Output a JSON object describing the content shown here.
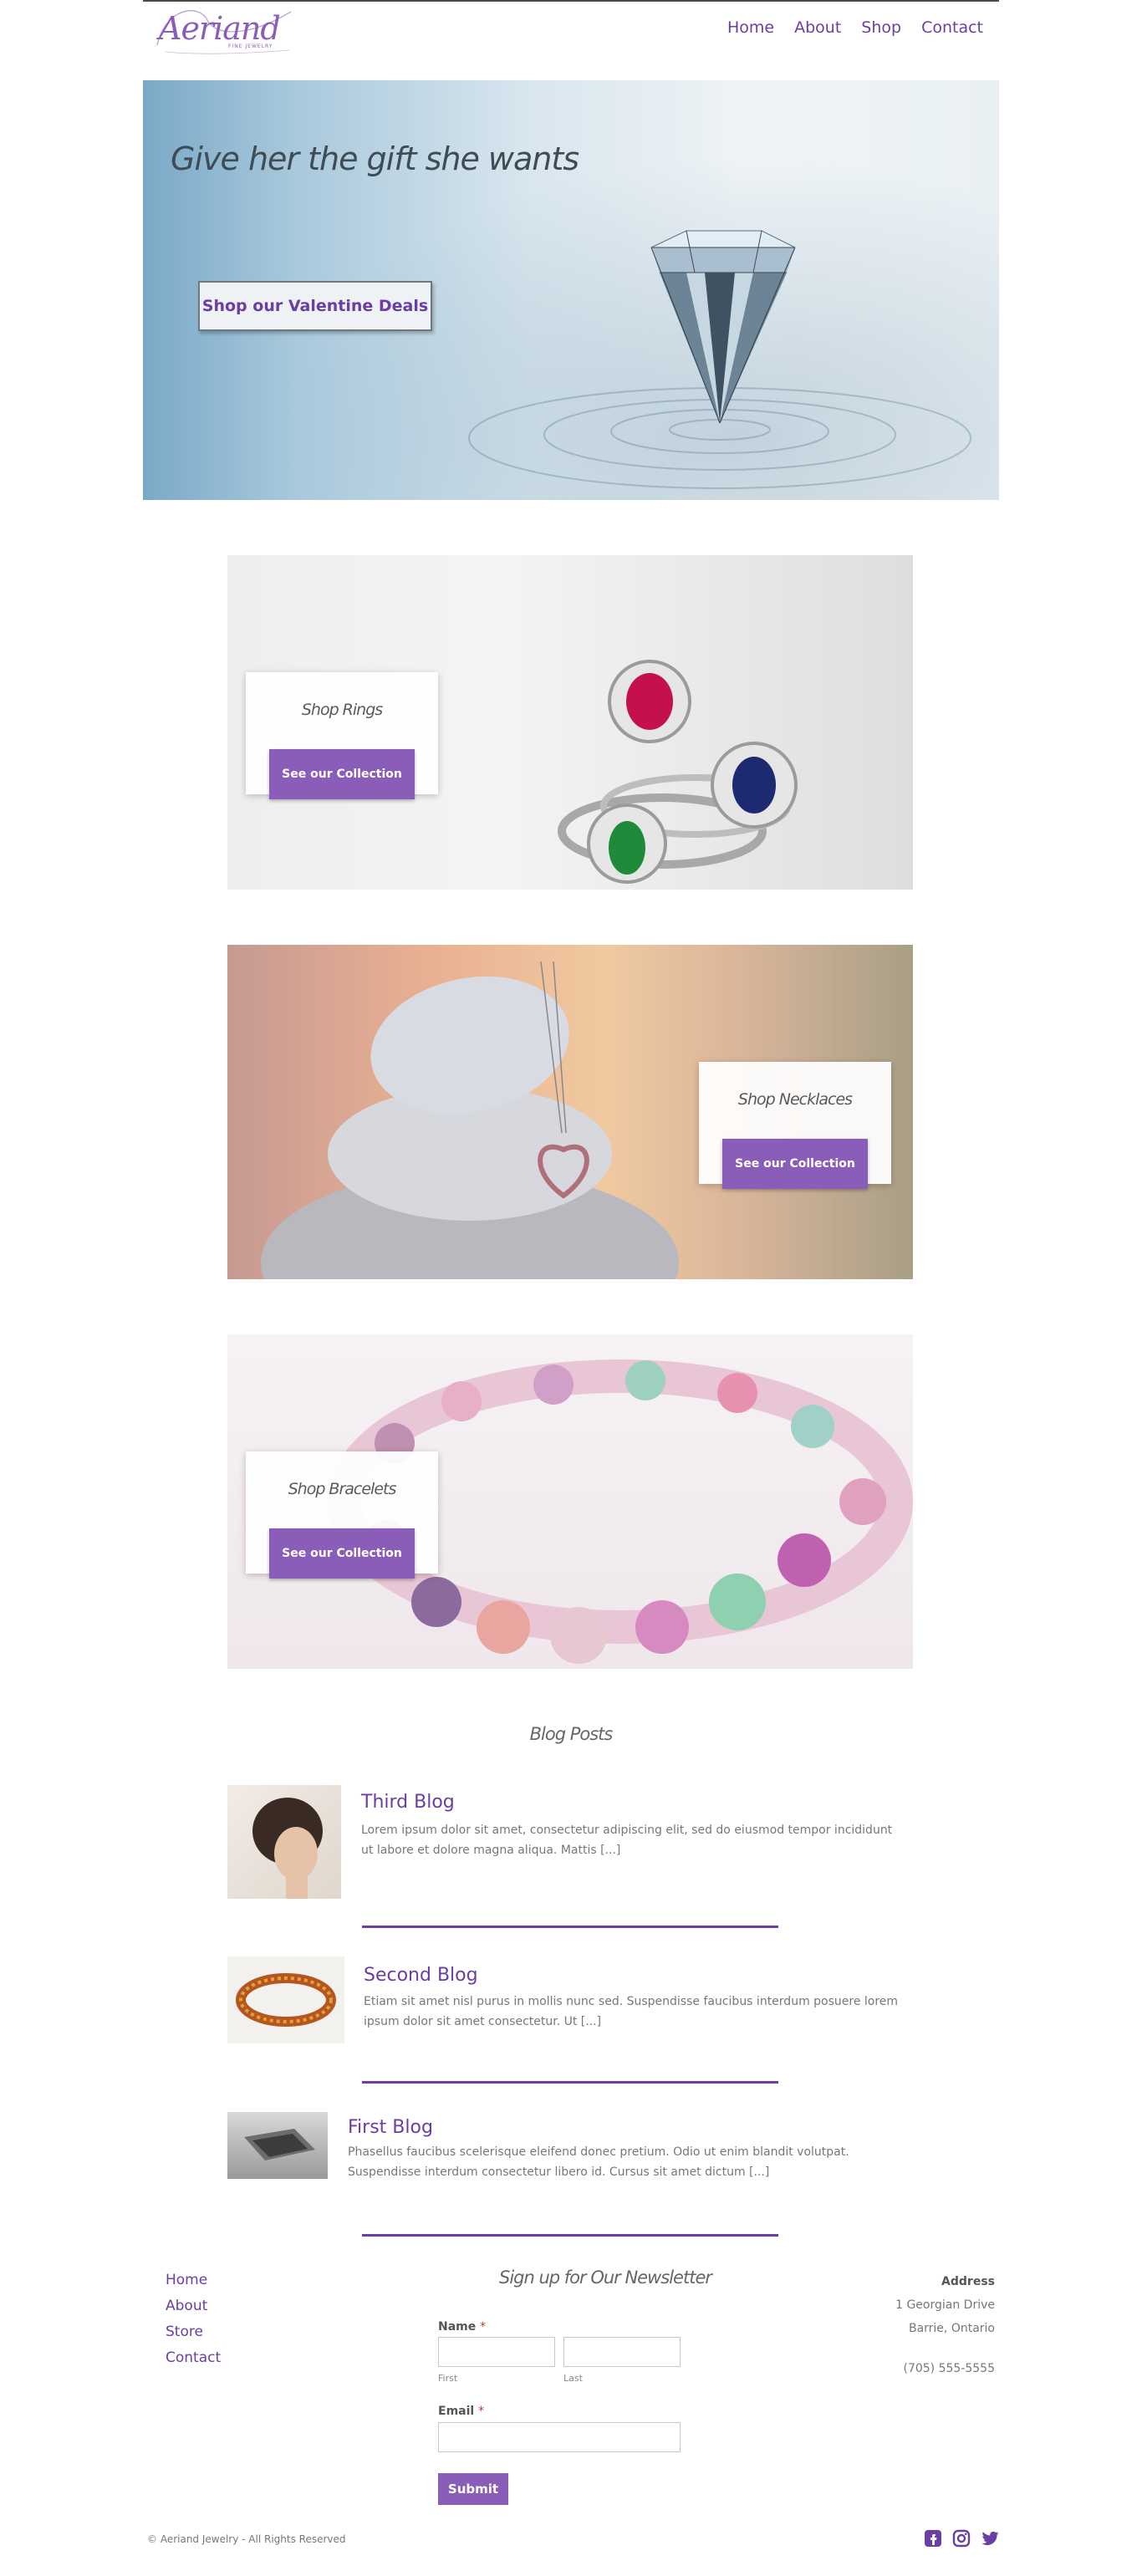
{
  "header": {
    "logo_text": "Aeriand",
    "logo_subtext": "FINE JEWELRY",
    "nav": [
      "Home",
      "About",
      "Shop",
      "Contact"
    ]
  },
  "hero": {
    "title": "Give her the gift she wants",
    "button": "Shop our Valentine Deals"
  },
  "categories": [
    {
      "title": "Shop Rings",
      "button": "See our Collection"
    },
    {
      "title": "Shop Necklaces",
      "button": "See our Collection"
    },
    {
      "title": "Shop Bracelets",
      "button": "See our Collection"
    }
  ],
  "blog": {
    "heading": "Blog Posts",
    "posts": [
      {
        "title": "Third Blog",
        "excerpt_1": "Lorem ipsum dolor sit amet, consectetur adipiscing elit, sed do eiusmod tempor incididunt",
        "excerpt_2": "ut labore et dolore magna aliqua. Mattis [...]"
      },
      {
        "title": "Second Blog",
        "excerpt_1": "Etiam sit amet nisl purus in mollis nunc sed. Suspendisse faucibus interdum posuere lorem",
        "excerpt_2": "ipsum dolor sit amet consectetur. Ut [...]"
      },
      {
        "title": "First Blog",
        "excerpt_1": "Phasellus faucibus scelerisque eleifend donec pretium. Odio ut enim blandit volutpat.",
        "excerpt_2": "Suspendisse interdum consectetur libero id. Cursus sit amet dictum [...]"
      }
    ]
  },
  "footer": {
    "nav": [
      "Home",
      "About",
      "Store",
      "Contact"
    ],
    "newsletter": {
      "title": "Sign up for Our Newsletter",
      "name_label": "Name",
      "first_sub": "First",
      "last_sub": "Last",
      "email_label": "Email",
      "required_mark": "*",
      "submit": "Submit"
    },
    "address": {
      "heading": "Address",
      "line1": "1 Georgian Drive",
      "line2": "Barrie, Ontario",
      "phone": "(705) 555-5555"
    },
    "copyright": "© Aeriand Jewelry - All Rights Reserved",
    "social_icons": [
      "facebook-icon",
      "instagram-icon",
      "twitter-icon"
    ]
  },
  "colors": {
    "accent": "#6a3ea4",
    "button": "#8a5db8"
  }
}
